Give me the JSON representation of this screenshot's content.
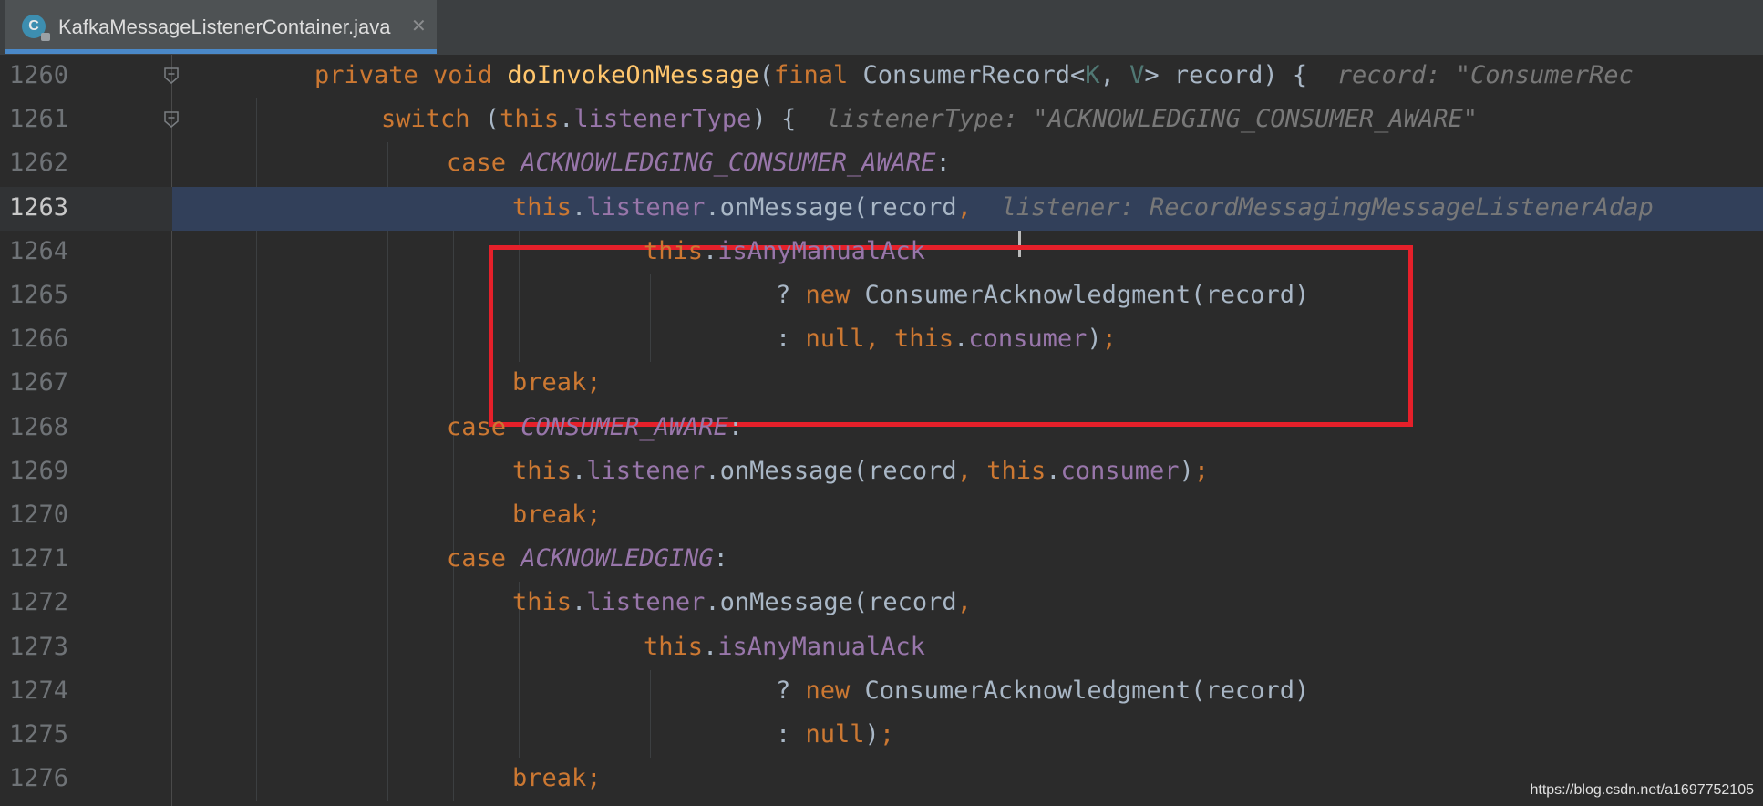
{
  "tab": {
    "icon_letter": "C",
    "title": "KafkaMessageListenerContainer.java",
    "close": "✕"
  },
  "lines": [
    {
      "num": "1260",
      "indent": 0,
      "segs": [
        [
          "kw",
          "private void "
        ],
        [
          "fn",
          "doInvokeOnMessage"
        ],
        [
          "",
          "("
        ],
        [
          "kw",
          "final "
        ],
        [
          "",
          "ConsumerRecord<"
        ],
        [
          "tp",
          "K"
        ],
        [
          "",
          ", "
        ],
        [
          "tp",
          "V"
        ],
        [
          "",
          "> record) {"
        ],
        [
          "hint",
          "  record: \"ConsumerRec"
        ]
      ]
    },
    {
      "num": "1261",
      "indent": 1,
      "segs": [
        [
          "kw",
          "switch "
        ],
        [
          "",
          "("
        ],
        [
          "kw",
          "this"
        ],
        [
          "",
          "."
        ],
        [
          "fld",
          "listenerType"
        ],
        [
          "",
          ") {"
        ],
        [
          "hint",
          "  listenerType: \"ACKNOWLEDGING_CONSUMER_AWARE\""
        ]
      ]
    },
    {
      "num": "1262",
      "indent": 2,
      "segs": [
        [
          "kw",
          "case "
        ],
        [
          "const",
          "ACKNOWLEDGING_CONSUMER_AWARE"
        ],
        [
          "",
          ":"
        ]
      ]
    },
    {
      "num": "1263",
      "indent": 3,
      "segs": [
        [
          "kw",
          "this"
        ],
        [
          "",
          "."
        ],
        [
          "fld",
          "listener"
        ],
        [
          "",
          ".onMessage(record"
        ],
        [
          "kw",
          ","
        ],
        [
          "hint",
          "  listener: RecordMessagingMessageListenerAdap"
        ]
      ]
    },
    {
      "num": "1264",
      "indent": 5,
      "segs": [
        [
          "kw",
          "this"
        ],
        [
          "",
          "."
        ],
        [
          "fld",
          "isAnyManualAck"
        ]
      ]
    },
    {
      "num": "1265",
      "indent": 7,
      "segs": [
        [
          "",
          "? "
        ],
        [
          "kw",
          "new "
        ],
        [
          "",
          "ConsumerAcknowledgment(record)"
        ]
      ]
    },
    {
      "num": "1266",
      "indent": 7,
      "segs": [
        [
          "",
          ": "
        ],
        [
          "kw",
          "null, this"
        ],
        [
          "",
          "."
        ],
        [
          "fld",
          "consumer"
        ],
        [
          "",
          ")"
        ],
        [
          "kw",
          ";"
        ]
      ]
    },
    {
      "num": "1267",
      "indent": 3,
      "segs": [
        [
          "kw",
          "break;"
        ]
      ]
    },
    {
      "num": "1268",
      "indent": 2,
      "segs": [
        [
          "kw",
          "case "
        ],
        [
          "const",
          "CONSUMER_AWARE"
        ],
        [
          "",
          ":"
        ]
      ]
    },
    {
      "num": "1269",
      "indent": 3,
      "segs": [
        [
          "kw",
          "this"
        ],
        [
          "",
          "."
        ],
        [
          "fld",
          "listener"
        ],
        [
          "",
          ".onMessage(record"
        ],
        [
          "kw",
          ", this"
        ],
        [
          "",
          "."
        ],
        [
          "fld",
          "consumer"
        ],
        [
          "",
          ")"
        ],
        [
          "kw",
          ";"
        ]
      ]
    },
    {
      "num": "1270",
      "indent": 3,
      "segs": [
        [
          "kw",
          "break;"
        ]
      ]
    },
    {
      "num": "1271",
      "indent": 2,
      "segs": [
        [
          "kw",
          "case "
        ],
        [
          "const",
          "ACKNOWLEDGING"
        ],
        [
          "",
          ":"
        ]
      ]
    },
    {
      "num": "1272",
      "indent": 3,
      "segs": [
        [
          "kw",
          "this"
        ],
        [
          "",
          "."
        ],
        [
          "fld",
          "listener"
        ],
        [
          "",
          ".onMessage(record"
        ],
        [
          "kw",
          ","
        ]
      ]
    },
    {
      "num": "1273",
      "indent": 5,
      "segs": [
        [
          "kw",
          "this"
        ],
        [
          "",
          "."
        ],
        [
          "fld",
          "isAnyManualAck"
        ]
      ]
    },
    {
      "num": "1274",
      "indent": 7,
      "segs": [
        [
          "",
          "? "
        ],
        [
          "kw",
          "new "
        ],
        [
          "",
          "ConsumerAcknowledgment(record)"
        ]
      ]
    },
    {
      "num": "1275",
      "indent": 7,
      "segs": [
        [
          "",
          ": "
        ],
        [
          "kw",
          "null"
        ],
        [
          "",
          ")"
        ],
        [
          "kw",
          ";"
        ]
      ]
    },
    {
      "num": "1276",
      "indent": 3,
      "segs": [
        [
          "kw",
          "break;"
        ]
      ]
    }
  ],
  "current_line": "1263",
  "watermark": "https://blog.csdn.net/a1697752105",
  "colors": {
    "background": "#2b2b2b",
    "keyword": "#cc7832",
    "method": "#ffc66d",
    "field": "#9876aa",
    "highlight_box": "#e5202a",
    "current_line_bg": "#32405a"
  }
}
